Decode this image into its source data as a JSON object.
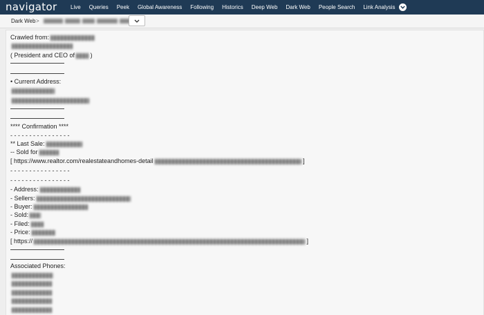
{
  "nav": {
    "logo_prefix": "navigat",
    "logo_o": "o",
    "logo_suffix": "r",
    "items": [
      "Live",
      "Queries",
      "Peek",
      "Global Awareness",
      "Following",
      "Historics",
      "Deep Web",
      "Dark Web",
      "People Search",
      "Link Analysis"
    ],
    "dropdown_icon": "chevron-down-icon"
  },
  "breadcrumb": {
    "root": "Dark Web",
    "separator": ">",
    "select_icon": "chevron-down-icon"
  },
  "content": {
    "crawled_from": "Crawled from:",
    "role": "( President and CEO of",
    "role_close": ")",
    "rule": "________________",
    "current_address": "• Current Address:",
    "confirmation": "**** Confirmation ****",
    "dashes": "- - - - - - - - - - - - - - - -",
    "last_sale": "** Last Sale:",
    "sold_for": "-- Sold for",
    "realtor_link_prefix": "[ https://www.realtor.com/realestateandhomes-detail",
    "link_close": "]",
    "address": "- Address:",
    "sellers": "- Sellers:",
    "buyer": "- Buyer:",
    "sold": "- Sold:",
    "filed": "- Filed:",
    "price": "- Price:",
    "second_link_prefix": "[ https://",
    "associated_phones": "Associated Phones:"
  }
}
